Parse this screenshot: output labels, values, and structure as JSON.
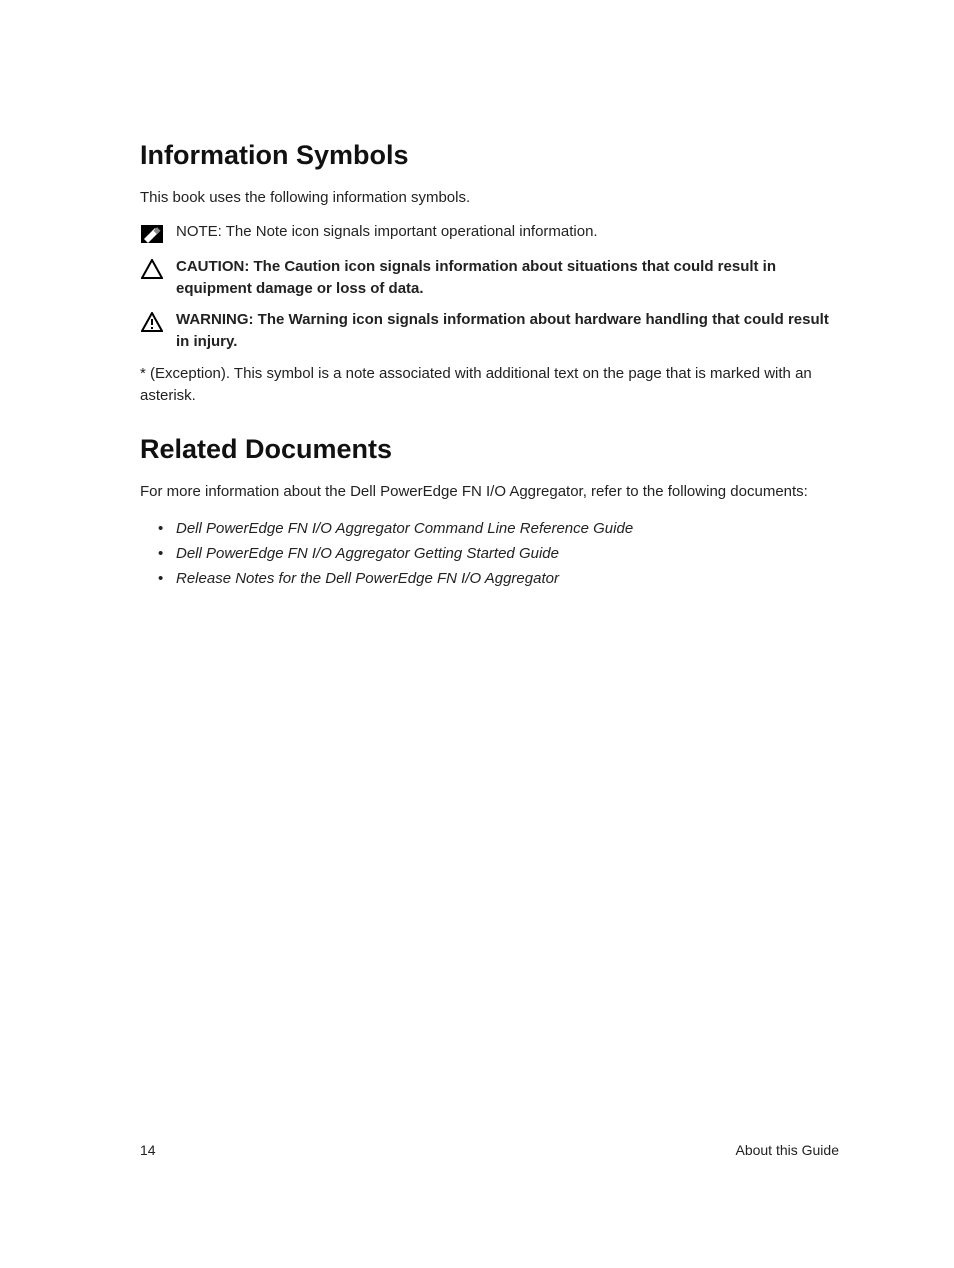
{
  "section1": {
    "heading": "Information Symbols",
    "intro": "This book uses the following information symbols.",
    "note_label": "NOTE: ",
    "note_text": "The Note icon signals important operational information.",
    "caution_label": "CAUTION: ",
    "caution_text": "The Caution icon signals information about situations that could result in equipment damage or loss of data.",
    "warning_label": "WARNING: ",
    "warning_text": "The Warning icon signals information about hardware handling that could result in injury.",
    "exception": "* (Exception). This symbol is a note associated with additional text on the page that is marked with an asterisk."
  },
  "section2": {
    "heading": "Related Documents",
    "intro": "For more information about the Dell PowerEdge FN I/O Aggregator, refer to the following documents:",
    "docs": [
      "Dell PowerEdge FN I/O Aggregator Command Line Reference Guide",
      "Dell PowerEdge FN I/O Aggregator Getting Started Guide",
      "Release Notes for the Dell PowerEdge FN I/O Aggregator"
    ]
  },
  "footer": {
    "page": "14",
    "title": "About this Guide"
  }
}
